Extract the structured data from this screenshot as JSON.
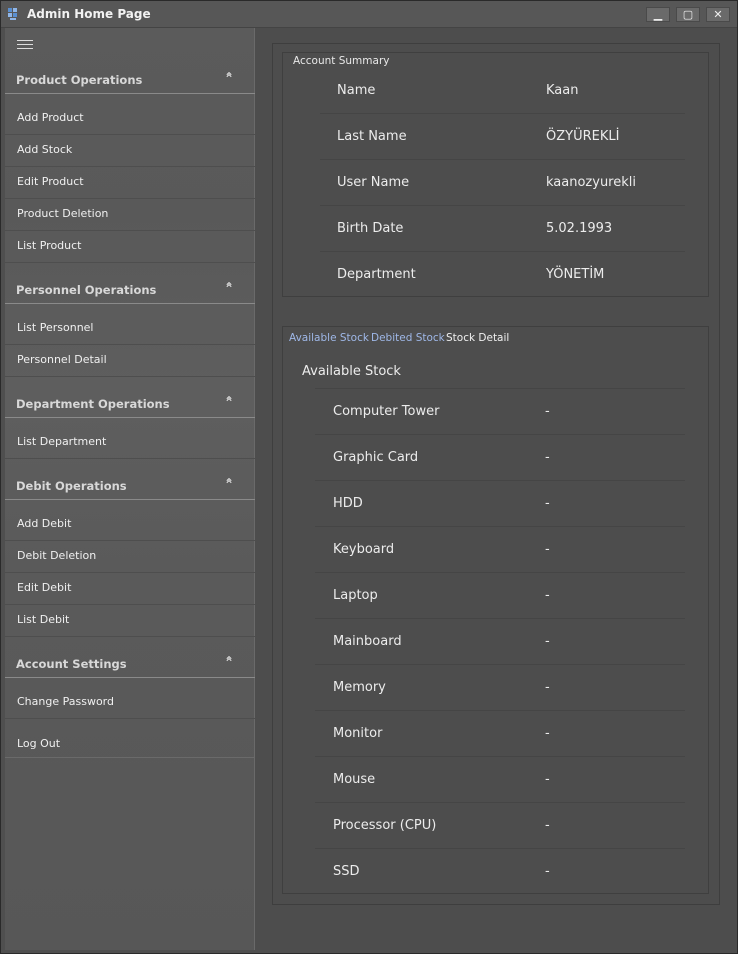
{
  "window": {
    "title": "Admin Home Page",
    "controls": {
      "minimize": "▁",
      "maximize": "▢",
      "close": "✕"
    }
  },
  "sidebar": {
    "menu_icon": "hamburger-icon",
    "groups": [
      {
        "title": "Product Operations",
        "items": [
          "Add Product",
          "Add Stock",
          "Edit Product",
          "Product Deletion",
          "List Product"
        ]
      },
      {
        "title": "Personnel Operations",
        "items": [
          "List Personnel",
          "Personnel Detail"
        ]
      },
      {
        "title": "Department Operations",
        "items": [
          "List Department"
        ]
      },
      {
        "title": "Debit Operations",
        "items": [
          "Add Debit",
          "Debit Deletion",
          "Edit Debit",
          "List Debit"
        ]
      },
      {
        "title": "Account Settings",
        "items": [
          "Change Password",
          "Log Out"
        ]
      }
    ],
    "collapse_glyph": "⌃"
  },
  "account_summary": {
    "title": "Account Summary",
    "rows": [
      {
        "label": "Name",
        "value": "Kaan"
      },
      {
        "label": "Last Name",
        "value": "ÖZYÜREKLİ"
      },
      {
        "label": "User Name",
        "value": "kaanozyurekli"
      },
      {
        "label": "Birth Date",
        "value": "5.02.1993"
      },
      {
        "label": "Department",
        "value": "YÖNETİM"
      }
    ]
  },
  "stock": {
    "tabs": [
      "Available Stock",
      "Debited Stock",
      "Stock Detail"
    ],
    "heading": "Available Stock",
    "rows": [
      {
        "label": "Computer Tower",
        "value": "-"
      },
      {
        "label": "Graphic Card",
        "value": "-"
      },
      {
        "label": "HDD",
        "value": "-"
      },
      {
        "label": "Keyboard",
        "value": "-"
      },
      {
        "label": "Laptop",
        "value": "-"
      },
      {
        "label": "Mainboard",
        "value": "-"
      },
      {
        "label": "Memory",
        "value": "-"
      },
      {
        "label": "Monitor",
        "value": "-"
      },
      {
        "label": "Mouse",
        "value": "-"
      },
      {
        "label": "Processor (CPU)",
        "value": "-"
      },
      {
        "label": "SSD",
        "value": "-"
      }
    ]
  },
  "colors": {
    "link": "#9fb8e8",
    "panel": "#4d4d4d",
    "sidebar": "#5a5a5a"
  }
}
